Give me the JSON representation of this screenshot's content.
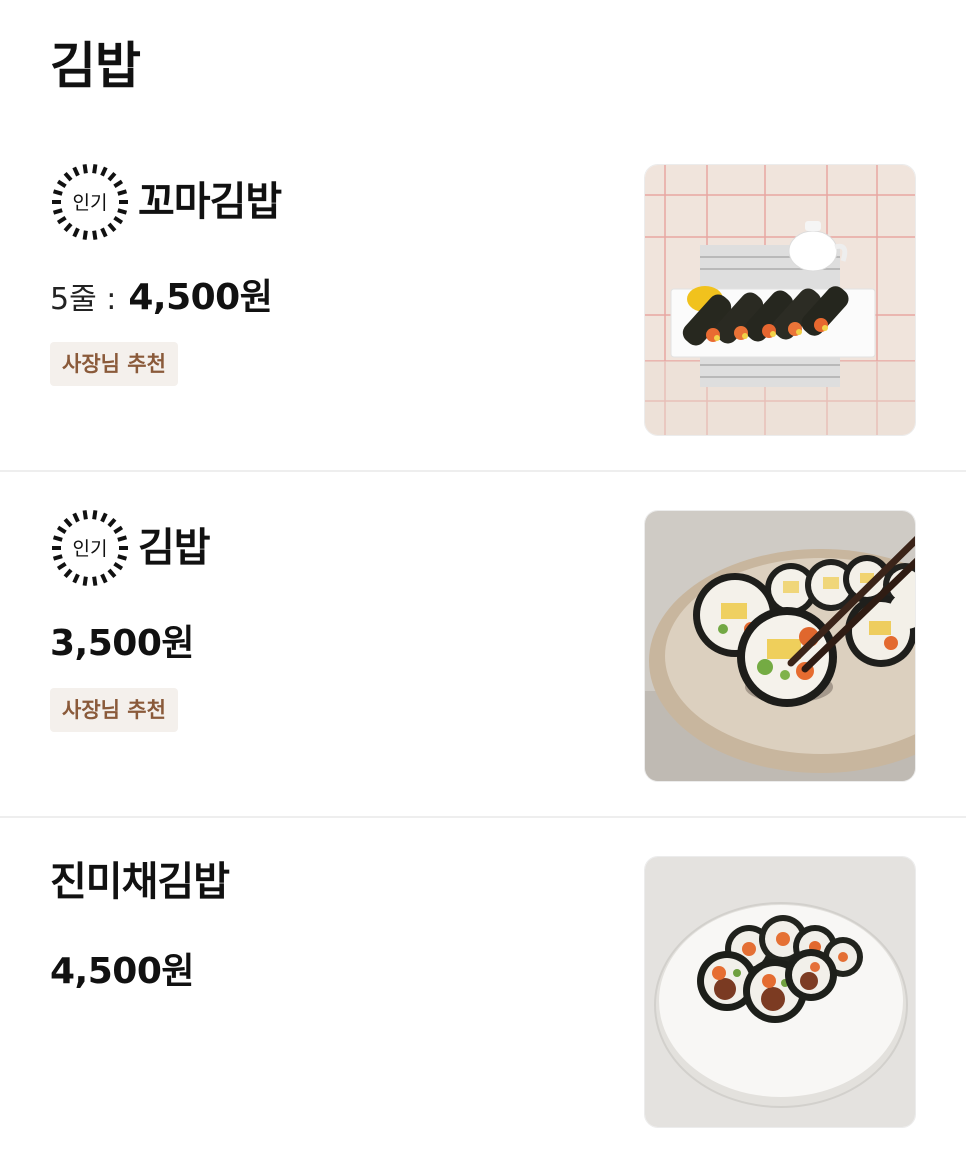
{
  "category": {
    "title": "김밥"
  },
  "items": [
    {
      "badge": "인기",
      "name": "꼬마김밥",
      "quantity": "5줄 :",
      "price": "4,500원",
      "tag": "사장님 추천"
    },
    {
      "badge": "인기",
      "name": "김밥",
      "price": "3,500원",
      "tag": "사장님 추천"
    },
    {
      "name": "진미채김밥",
      "price": "4,500원"
    }
  ],
  "colors": {
    "tag_background": "#f4f0ec",
    "tag_text": "#8a5a3a",
    "divider": "#eeeeee",
    "text": "#111111"
  },
  "icons": {
    "popular_badge": "sunburst-badge-icon"
  }
}
